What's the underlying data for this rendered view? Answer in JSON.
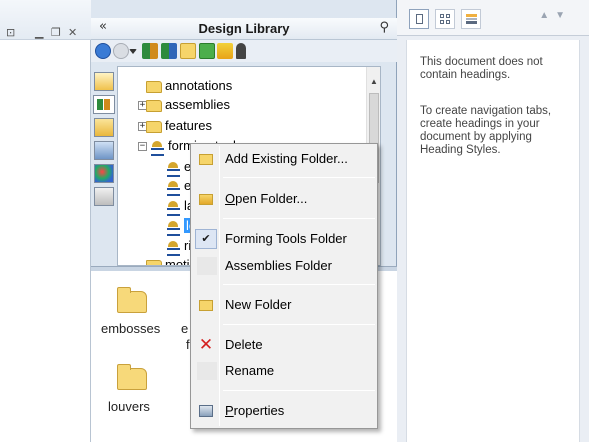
{
  "design_library": {
    "title": "Design Library",
    "collapse_glyph": "«",
    "pin_glyph": "⚲",
    "tree": {
      "items": [
        {
          "label": "annotations",
          "icon": "folder-icon"
        },
        {
          "label": "assemblies",
          "icon": "folder-icon"
        },
        {
          "label": "features",
          "icon": "folder-icon"
        },
        {
          "label": "forming tools",
          "visible_label": "forming tool",
          "icon": "forming-tool-icon"
        },
        {
          "label": "emb",
          "icon": "forming-tool-icon"
        },
        {
          "label": "extr",
          "icon": "forming-tool-icon"
        },
        {
          "label": "lanc",
          "icon": "forming-tool-icon"
        },
        {
          "label": "louv",
          "icon": "forming-tool-icon",
          "selected": true
        },
        {
          "label": "ribs",
          "icon": "forming-tool-icon"
        },
        {
          "label": "motion",
          "icon": "folder-icon"
        }
      ]
    },
    "bottom_pane": {
      "items": [
        {
          "label": "embosses"
        },
        {
          "label": "e"
        },
        {
          "label": "f"
        },
        {
          "label": "louvers"
        }
      ]
    }
  },
  "context_menu": {
    "items": [
      {
        "label": "Add Existing Folder...",
        "icon": "add-folder-icon"
      },
      {
        "label": "Open Folder...",
        "underline": "O",
        "rest": "pen Folder...",
        "icon": "open-folder-icon"
      },
      {
        "label": "Forming Tools Folder",
        "checked": true
      },
      {
        "label": "Assemblies Folder"
      },
      {
        "label": "New Folder",
        "icon": "new-folder-icon"
      },
      {
        "label": "Delete",
        "icon": "delete-x-icon"
      },
      {
        "label": "Rename"
      },
      {
        "label": "Properties",
        "underline": "P",
        "rest": "roperties",
        "icon": "properties-icon"
      }
    ],
    "check_glyph": "✔",
    "delete_glyph": "✕"
  },
  "doc_panel": {
    "text1": "This document does not contain headings.",
    "text2": "To create navigation tabs, create headings in your document by applying Heading Styles."
  },
  "colors": {
    "selection": "#3399ff",
    "folder": "#f6d56a",
    "delete_red": "#d42020"
  }
}
